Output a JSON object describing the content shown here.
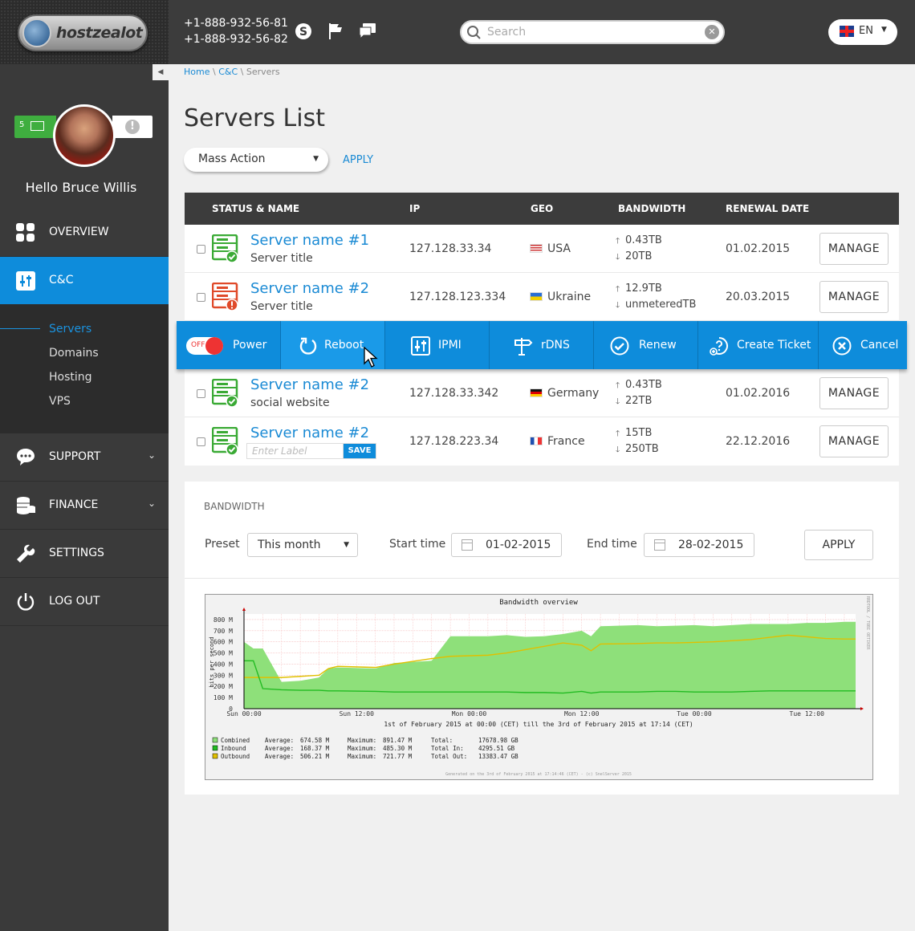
{
  "brand": {
    "name": "hostzealot"
  },
  "header": {
    "phone1": "+1-888-932-56-81",
    "phone2": "+1-888-932-56-82",
    "search_placeholder": "Search",
    "lang": "EN"
  },
  "user": {
    "mail_count": "5",
    "greeting": "Hello",
    "name": "Bruce Willis"
  },
  "nav": {
    "overview": "OVERVIEW",
    "cc": "C&C",
    "sub": [
      "Servers",
      "Domains",
      "Hosting",
      "VPS"
    ],
    "support": "SUPPORT",
    "finance": "FINANCE",
    "settings": "SETTINGS",
    "logout": "LOG OUT"
  },
  "breadcrumb": {
    "home": "Home",
    "cc": "C&C",
    "current": "Servers",
    "sep": " \\ "
  },
  "page": {
    "title": "Servers List",
    "mass_action": "Mass Action",
    "apply": "APPLY"
  },
  "table": {
    "headers": [
      "STATUS & NAME",
      "IP",
      "GEO",
      "BANDWIDTH",
      "RENEWAL DATE"
    ],
    "manage_label": "MANAGE",
    "rows": [
      {
        "name": "Server name #1",
        "subtitle": "Server title",
        "ip": "127.128.33.34",
        "geo": "USA",
        "bw_up": "0.43TB",
        "bw_down": "20TB",
        "renewal": "01.02.2015",
        "status": "ok"
      },
      {
        "name": "Server name #2",
        "subtitle": "Server title",
        "ip": "127.128.123.334",
        "geo": "Ukraine",
        "bw_up": "12.9TB",
        "bw_down": "unmeteredTB",
        "renewal": "20.03.2015",
        "status": "error"
      },
      {
        "name": "Server name #2",
        "subtitle": "social website",
        "ip": "127.128.33.342",
        "geo": "Germany",
        "bw_up": "0.43TB",
        "bw_down": "22TB",
        "renewal": "01.02.2016",
        "status": "ok"
      },
      {
        "name": "Server name #2",
        "subtitle": "",
        "ip": "127.128.223.34",
        "geo": "France",
        "bw_up": "15TB",
        "bw_down": "250TB",
        "renewal": "22.12.2016",
        "status": "ok"
      }
    ],
    "label_placeholder": "Enter Label",
    "save": "SAVE"
  },
  "actions": {
    "toggle": "OFF",
    "power": "Power",
    "reboot": "Reboot",
    "ipmi": "IPMI",
    "rdns": "rDNS",
    "renew": "Renew",
    "ticket": "Create Ticket",
    "cancel": "Cancel"
  },
  "bandwidth": {
    "title": "BANDWIDTH",
    "preset_label": "Preset",
    "preset_value": "This month",
    "start_label": "Start time",
    "start_value": "01-02-2015",
    "end_label": "End time",
    "end_value": "28-02-2015",
    "apply": "APPLY"
  },
  "chart_data": {
    "type": "area",
    "title": "Bandwidth overview",
    "ylabel": "bits per second",
    "yticks": [
      "800 M",
      "700 M",
      "600 M",
      "500 M",
      "400 M",
      "300 M",
      "200 M",
      "100 M",
      "0"
    ],
    "xticks": [
      "Sun 00:00",
      "Sun 12:00",
      "Mon 00:00",
      "Mon 12:00",
      "Tue 00:00",
      "Tue 12:00"
    ],
    "subtitle": "1st of February 2015 at 00:00 (CET) till the 3rd of February 2015 at 17:14 (CET)",
    "side_text": "RRDTOOL / TOBI OETIKER",
    "footer": "Generated on the 3rd of February 2015 at 17:14:46 (CET) - (c) SnelServer 2015",
    "ylim": [
      0,
      850
    ],
    "legend": [
      {
        "name": "Combined",
        "color": "#8ee07a",
        "avg": "674.58 M",
        "max": "891.47 M",
        "total_label": "Total:",
        "total": "17678.98 GB"
      },
      {
        "name": "Inbound",
        "color": "#22bb22",
        "avg": "168.37 M",
        "max": "485.30 M",
        "total_label": "Total In:",
        "total": "4295.51 GB"
      },
      {
        "name": "Outbound",
        "color": "#e0c000",
        "avg": "506.21 M",
        "max": "721.77 M",
        "total_label": "Total Out:",
        "total": "13383.47 GB"
      }
    ],
    "legend_labels": {
      "average": "Average:",
      "maximum": "Maximum:"
    },
    "series": [
      {
        "name": "Combined",
        "x_hours": [
          0,
          1,
          2,
          4,
          6,
          8,
          9,
          10,
          14,
          16,
          20,
          22,
          26,
          28,
          30,
          32,
          34,
          36,
          37,
          38,
          42,
          44,
          46,
          48,
          50,
          52,
          54,
          56,
          58,
          60,
          62,
          64,
          65.2
        ],
        "values": [
          600,
          540,
          540,
          240,
          250,
          280,
          360,
          370,
          360,
          410,
          430,
          650,
          650,
          660,
          645,
          650,
          670,
          700,
          650,
          740,
          750,
          740,
          745,
          750,
          740,
          750,
          760,
          760,
          760,
          770,
          770,
          780,
          780
        ]
      },
      {
        "name": "Outbound",
        "x_hours": [
          0,
          1,
          2,
          4,
          6,
          8,
          9,
          10,
          14,
          16,
          20,
          22,
          26,
          28,
          30,
          32,
          34,
          36,
          37,
          38,
          42,
          44,
          46,
          48,
          50,
          52,
          54,
          56,
          58,
          60,
          62,
          64,
          65.2
        ],
        "values": [
          280,
          280,
          280,
          280,
          290,
          300,
          360,
          380,
          370,
          400,
          450,
          470,
          480,
          500,
          530,
          560,
          590,
          570,
          520,
          580,
          585,
          590,
          590,
          595,
          600,
          610,
          620,
          640,
          660,
          645,
          630,
          625,
          625
        ]
      },
      {
        "name": "Inbound",
        "x_hours": [
          0,
          1,
          2,
          4,
          6,
          8,
          9,
          10,
          14,
          16,
          20,
          22,
          26,
          28,
          30,
          32,
          34,
          36,
          37,
          38,
          42,
          44,
          46,
          48,
          50,
          52,
          54,
          56,
          58,
          60,
          62,
          64,
          65.2
        ],
        "values": [
          430,
          430,
          180,
          170,
          165,
          165,
          160,
          160,
          155,
          150,
          150,
          150,
          150,
          150,
          145,
          145,
          140,
          155,
          140,
          150,
          150,
          155,
          155,
          150,
          150,
          150,
          155,
          160,
          160,
          160,
          160,
          160,
          160
        ]
      }
    ],
    "colors": {
      "combined": "#8ee07a",
      "inbound": "#22bb22",
      "outbound": "#e0c000",
      "grid": "#f4b5b5"
    }
  }
}
